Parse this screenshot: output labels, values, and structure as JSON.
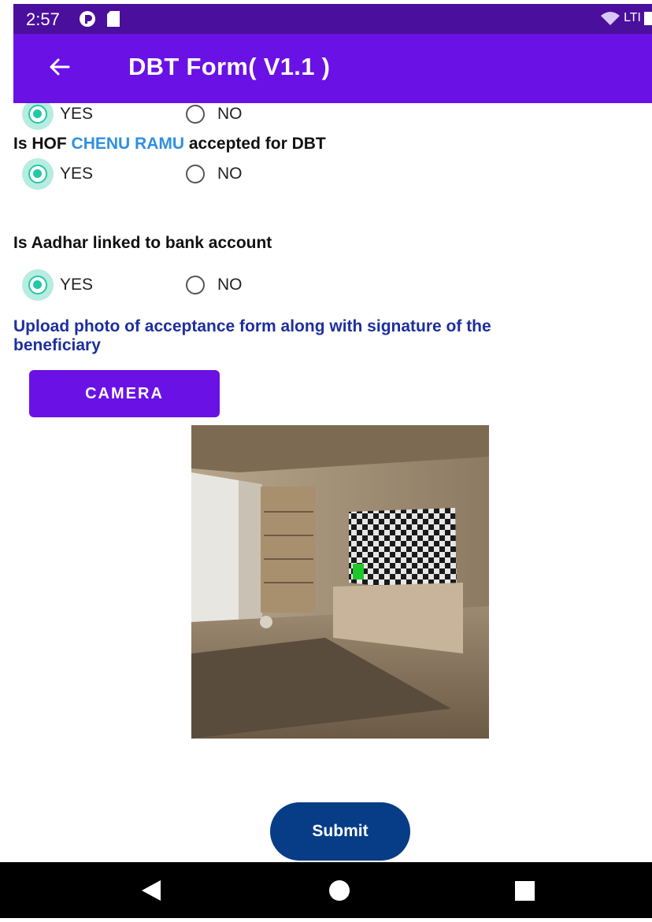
{
  "status_bar": {
    "time": "2:57",
    "right_text": "LTI"
  },
  "app_bar": {
    "title": "DBT Form( V1.1 )"
  },
  "form": {
    "q0": {
      "yes": "YES",
      "no": "NO",
      "selected": "YES"
    },
    "q1": {
      "prefix": "Is HOF",
      "name": "CHENU RAMU",
      "suffix": "accepted for DBT",
      "yes": "YES",
      "no": "NO",
      "selected": "YES"
    },
    "q2": {
      "text": "Is Aadhar linked to bank account",
      "yes": "YES",
      "no": "NO",
      "selected": "YES"
    },
    "upload_text_1": "Upload photo of acceptance form along with signature of the",
    "upload_text_2": "beneficiary",
    "camera_label": "CAMERA",
    "submit_label": "Submit"
  },
  "colors": {
    "primary": "#6a11e6",
    "status_bar": "#4b0f9e",
    "radio_accent": "#24c7a8",
    "name_highlight": "#2f8fe0",
    "upload_text": "#1d2f9d",
    "submit": "#073c86"
  },
  "icons": {
    "back": "arrow-left-icon",
    "nav": [
      "back-triangle-icon",
      "home-circle-icon",
      "recents-square-icon"
    ]
  }
}
